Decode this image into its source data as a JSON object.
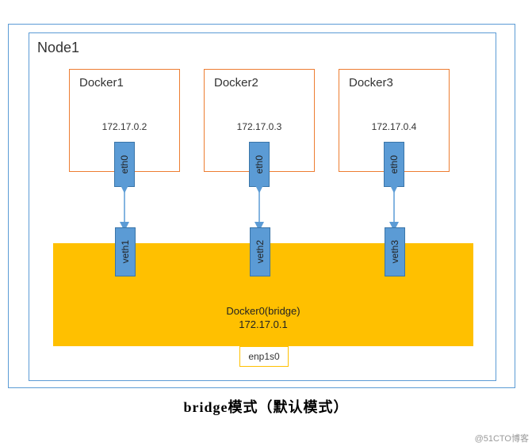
{
  "outer": {
    "node_label": "Node1"
  },
  "dockers": [
    {
      "name": "Docker1",
      "ip": "172.17.0.2",
      "eth": "eth0",
      "veth": "veth1"
    },
    {
      "name": "Docker2",
      "ip": "172.17.0.3",
      "eth": "eth0",
      "veth": "veth2"
    },
    {
      "name": "Docker3",
      "ip": "172.17.0.4",
      "eth": "eth0",
      "veth": "veth3"
    }
  ],
  "bridge": {
    "name": "Docker0(bridge)",
    "ip": "172.17.0.1",
    "nic": "enp1s0"
  },
  "caption": "bridge模式（默认模式）",
  "watermark": "@51CTO博客",
  "chart_data": {
    "type": "diagram",
    "title": "bridge模式（默认模式）",
    "host": "Node1",
    "bridge": {
      "name": "Docker0(bridge)",
      "ip": "172.17.0.1",
      "physical_nic": "enp1s0"
    },
    "containers": [
      {
        "name": "Docker1",
        "ip": "172.17.0.2",
        "iface": "eth0",
        "peer": "veth1"
      },
      {
        "name": "Docker2",
        "ip": "172.17.0.3",
        "iface": "eth0",
        "peer": "veth2"
      },
      {
        "name": "Docker3",
        "ip": "172.17.0.4",
        "iface": "eth0",
        "peer": "veth3"
      }
    ]
  }
}
